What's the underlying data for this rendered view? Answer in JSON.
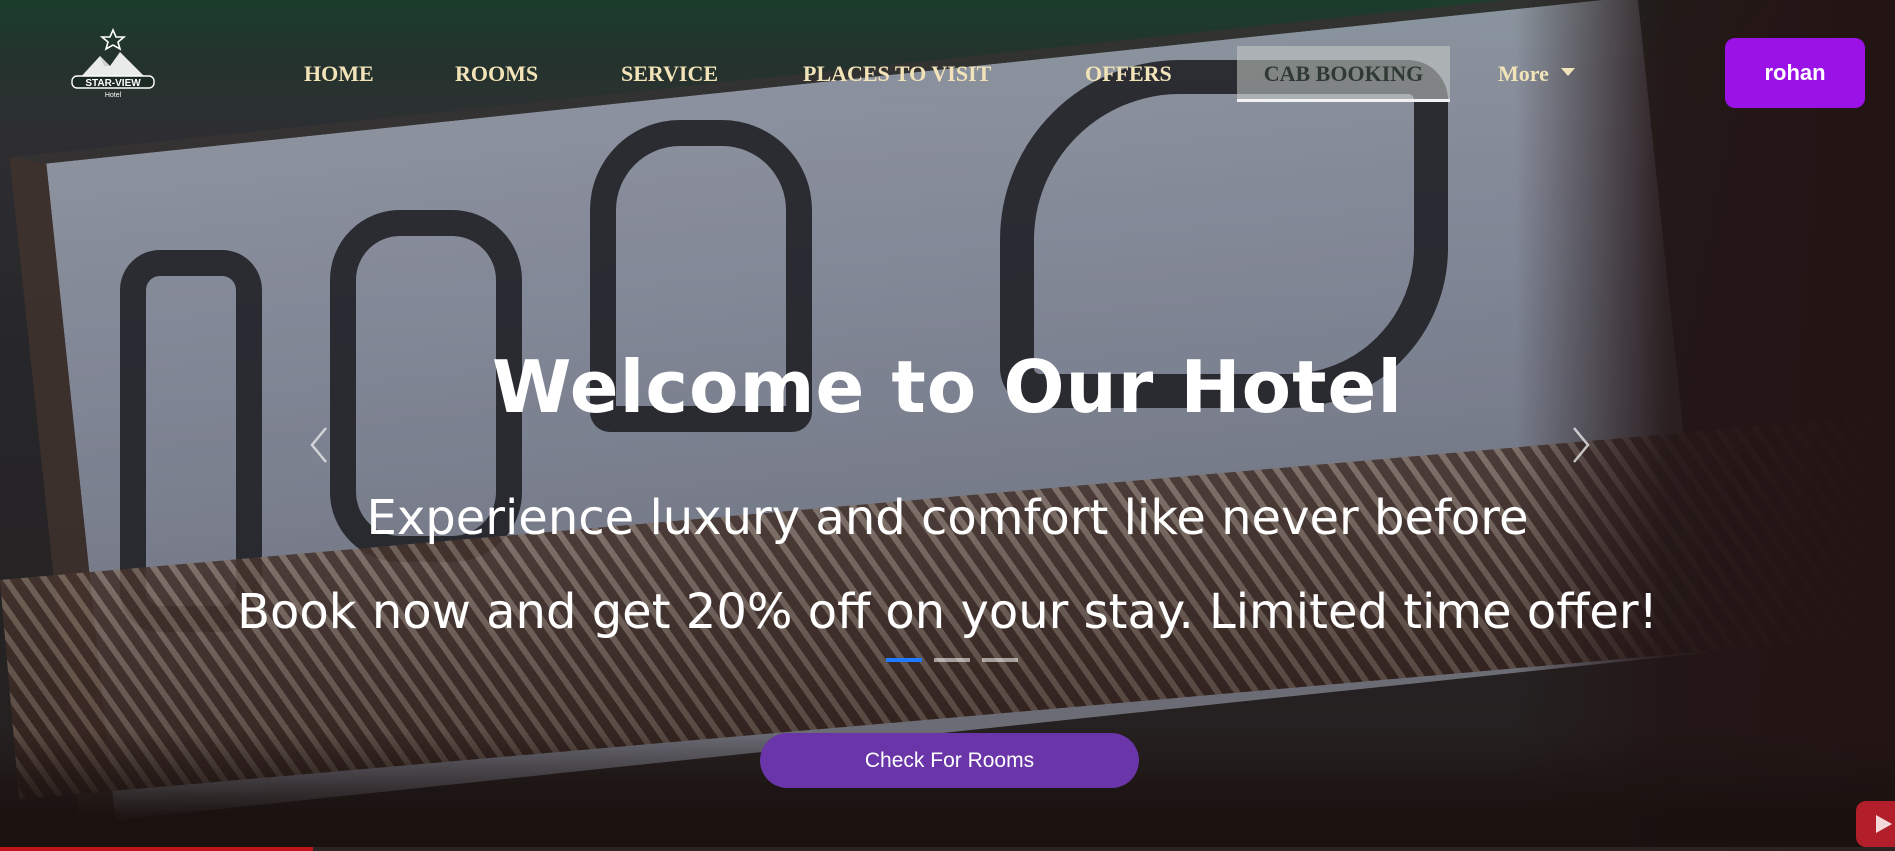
{
  "logo": {
    "brand": "STAR-VIEW",
    "sub": "Hotel"
  },
  "nav": {
    "items": [
      {
        "label": "HOME"
      },
      {
        "label": "ROOMS"
      },
      {
        "label": "SERVICE"
      },
      {
        "label": "PLACES TO VISIT"
      },
      {
        "label": "OFFERS"
      },
      {
        "label": "CAB BOOKING"
      },
      {
        "label": "More"
      }
    ],
    "active": "CAB BOOKING"
  },
  "user": {
    "name": "rohan"
  },
  "hero": {
    "title": "Welcome to Our Hotel",
    "subtitle": "Experience luxury and comfort like never before",
    "offer": "Book now and get 20% off on your stay. Limited time offer!",
    "cta": "Check For Rooms"
  },
  "carousel": {
    "slide_count": 3,
    "active_index": 0
  },
  "video": {
    "progress_fraction": 0.165
  },
  "colors": {
    "nav_text": "#f2e3b8",
    "user_button": "#9b12e6",
    "cta_button": "#6a35a8",
    "indicator_active": "#1e7bff",
    "video_progress": "#c0141c"
  }
}
